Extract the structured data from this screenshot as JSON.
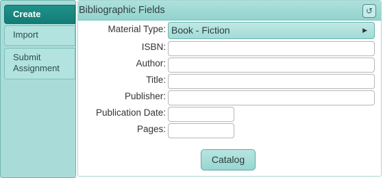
{
  "sidebar": {
    "tabs": [
      {
        "label": "Create"
      },
      {
        "label": "Import"
      },
      {
        "label": "Submit Assignment"
      }
    ]
  },
  "panel": {
    "title": "Bibliographic Fields",
    "header_icon": "refresh-icon"
  },
  "form": {
    "material_type": {
      "label": "Material Type:",
      "value": "Book - Fiction"
    },
    "isbn": {
      "label": "ISBN:",
      "value": ""
    },
    "author": {
      "label": "Author:",
      "value": ""
    },
    "title": {
      "label": "Title:",
      "value": ""
    },
    "publisher": {
      "label": "Publisher:",
      "value": ""
    },
    "publication_date": {
      "label": "Publication Date:",
      "value": ""
    },
    "pages": {
      "label": "Pages:",
      "value": ""
    }
  },
  "catalog_button": {
    "label": "Catalog"
  },
  "colors": {
    "accent": "#137d76",
    "panel_bg": "#a9dcd8"
  }
}
